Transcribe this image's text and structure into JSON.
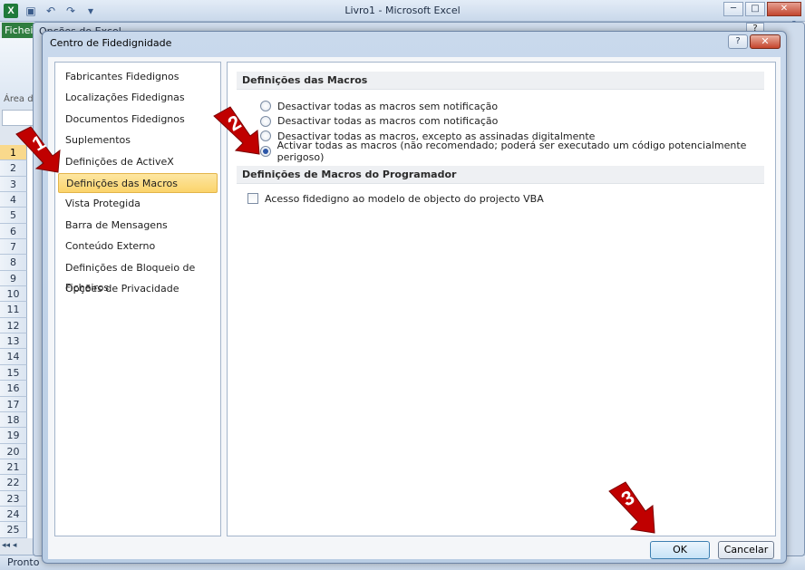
{
  "excel": {
    "logo": "X",
    "title": "Livro1  -  Microsoft Excel",
    "file_tab": "Fichei",
    "area_label": "Área d",
    "rows": [
      "1",
      "2",
      "3",
      "4",
      "5",
      "6",
      "7",
      "8",
      "9",
      "10",
      "11",
      "12",
      "13",
      "14",
      "15",
      "16",
      "17",
      "18",
      "19",
      "20",
      "21",
      "22",
      "23",
      "24",
      "25"
    ],
    "status": "Pronto",
    "window_controls": [
      "─",
      "□",
      "✕"
    ],
    "icons": [
      "save-icon",
      "undo-icon",
      "redo-icon",
      "customize-qat-icon"
    ]
  },
  "options": {
    "title": "Opções do Excel",
    "help": "?"
  },
  "dialog": {
    "title": "Centro de Fidedignidade",
    "help": "?",
    "close": "✕",
    "nav": [
      "Fabricantes Fidedignos",
      "Localizações Fidedignas",
      "Documentos Fidedignos",
      "Suplementos",
      "Definições de ActiveX",
      "Definições das Macros",
      "Vista Protegida",
      "Barra de Mensagens",
      "Conteúdo Externo",
      "Definições de Bloqueio de Ficheiros",
      "Opções de Privacidade"
    ],
    "selected_nav_index": 5,
    "macro_section": {
      "header": "Definições das Macros",
      "options": [
        "Desactivar todas as macros sem notificação",
        "Desactivar todas as macros com notificação",
        "Desactivar todas as macros, excepto as assinadas digitalmente",
        "Activar todas as macros (não recomendado; poderá ser executado um código potencialmente perigoso)"
      ],
      "selected_index": 3
    },
    "developer_section": {
      "header": "Definições de Macros do Programador",
      "checkbox_label": "Acesso fidedigno ao modelo de objecto do projecto VBA",
      "checked": false
    },
    "ok_label": "OK",
    "cancel_label": "Cancelar"
  },
  "annotations": {
    "arrow_1": "1",
    "arrow_2": "2",
    "arrow_3": "3",
    "color": "#c00000"
  }
}
